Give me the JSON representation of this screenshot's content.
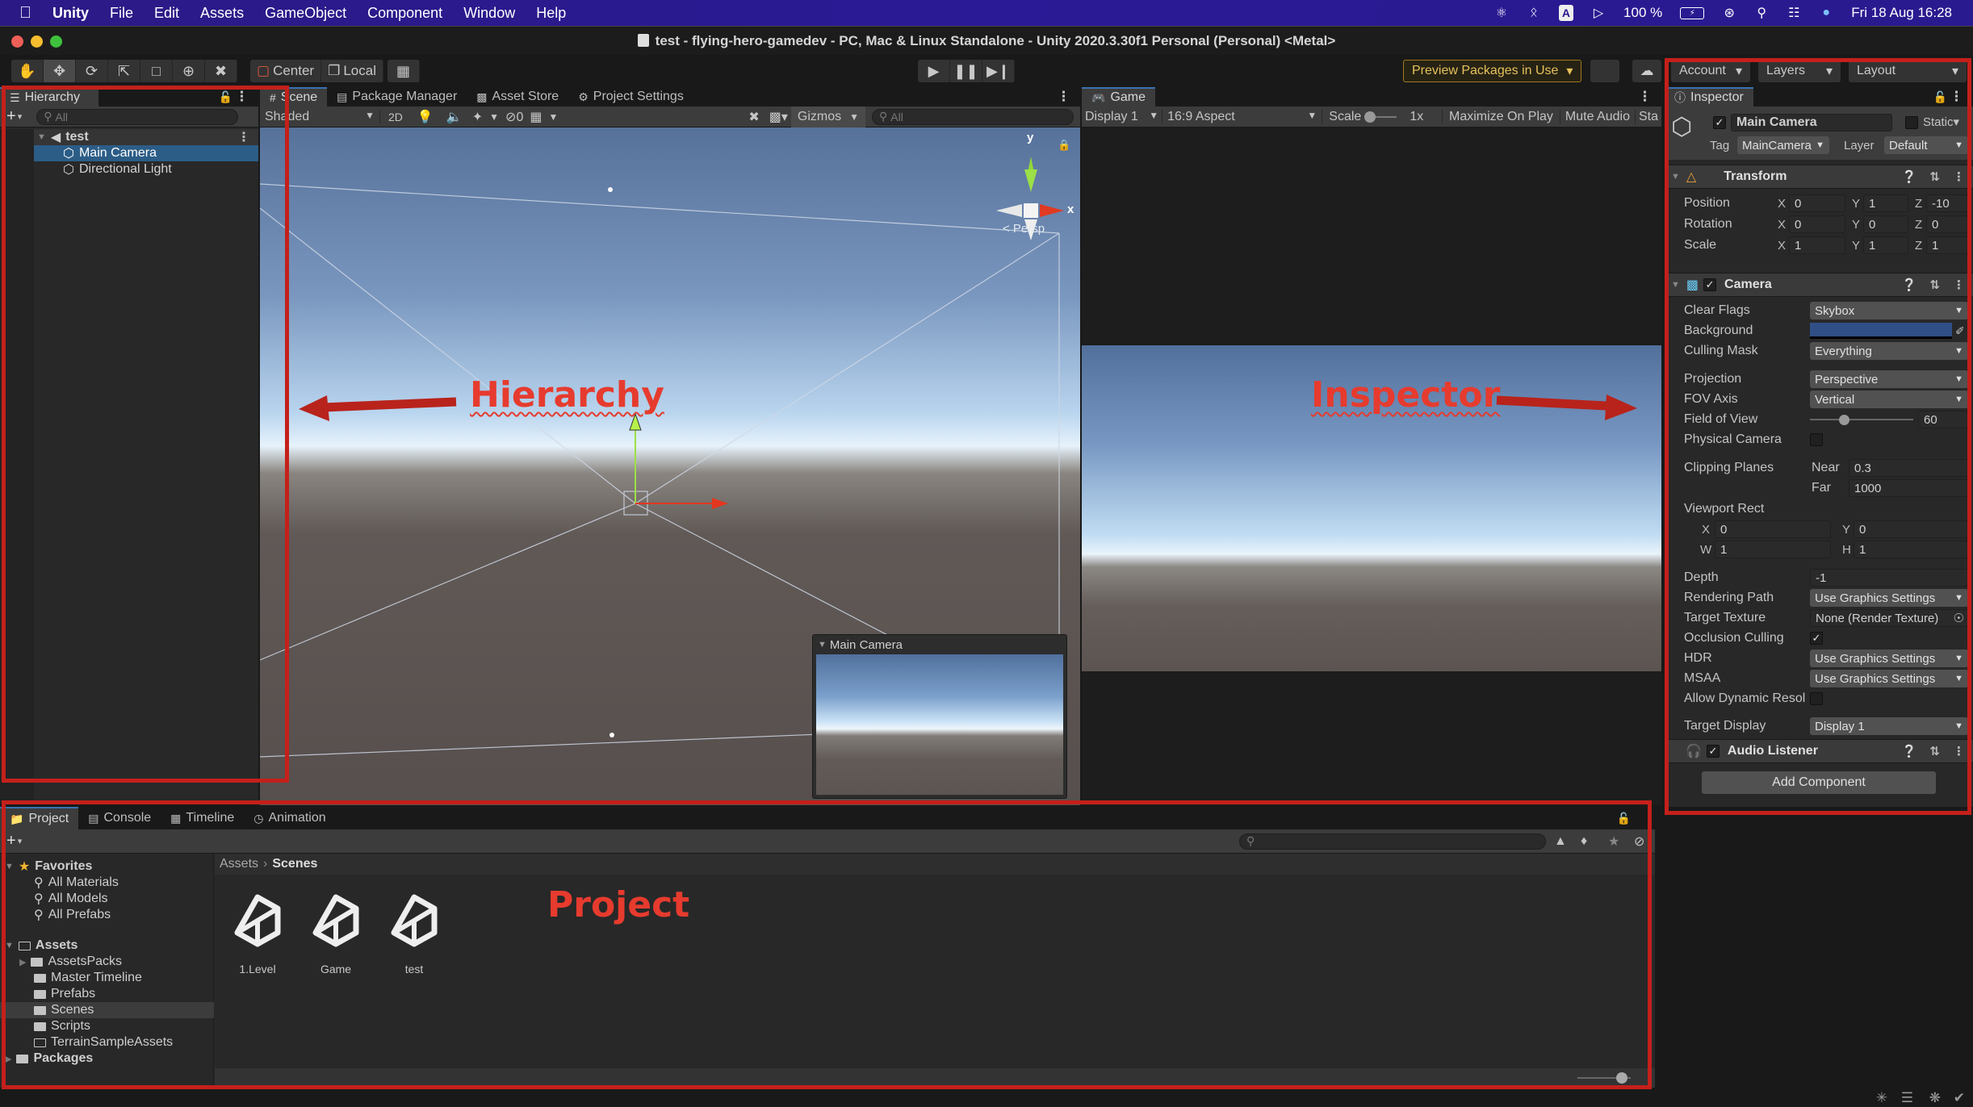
{
  "menubar": {
    "apple": "",
    "app": "Unity",
    "items": [
      "File",
      "Edit",
      "Assets",
      "GameObject",
      "Component",
      "Window",
      "Help"
    ],
    "status": {
      "keyboard": "A",
      "battery": "100 %",
      "datetime": "Fri 18 Aug  16:28"
    }
  },
  "window": {
    "title": "test - flying-hero-gamedev - PC, Mac & Linux Standalone - Unity 2020.3.30f1 Personal (Personal) <Metal>"
  },
  "toolbar": {
    "tools": [
      "hand",
      "move",
      "rotate",
      "scale",
      "rect",
      "transform",
      "custom"
    ],
    "pivot_label": "Center",
    "space_label": "Local",
    "preview_packages": "Preview Packages in Use",
    "account": "Account",
    "layers": "Layers",
    "layout": "Layout"
  },
  "hierarchy": {
    "tab": "Hierarchy",
    "search_placeholder": "All",
    "scene": "test",
    "items": [
      "Main Camera",
      "Directional Light"
    ],
    "selected": "Main Camera"
  },
  "scene": {
    "tabs": [
      "Scene",
      "Package Manager",
      "Asset Store",
      "Project Settings"
    ],
    "shading": "Shaded",
    "mode_2d": "2D",
    "hidden_count": "0",
    "gizmos": "Gizmos",
    "search_placeholder": "All",
    "gizmo_axes": {
      "y": "y",
      "x": "x"
    },
    "projection": "< Persp",
    "camera_preview_title": "Main Camera"
  },
  "game": {
    "tab": "Game",
    "display": "Display 1",
    "aspect": "16:9 Aspect",
    "scale_label": "Scale",
    "scale_value": "1x",
    "maximize": "Maximize On Play",
    "mute": "Mute Audio",
    "stats": "Sta"
  },
  "inspector": {
    "tab": "Inspector",
    "object_name": "Main Camera",
    "active": true,
    "static_label": "Static",
    "tag_label": "Tag",
    "tag": "MainCamera",
    "layer_label": "Layer",
    "layer": "Default",
    "transform": {
      "title": "Transform",
      "rows": [
        {
          "label": "Position",
          "x": "0",
          "y": "1",
          "z": "-10"
        },
        {
          "label": "Rotation",
          "x": "0",
          "y": "0",
          "z": "0"
        },
        {
          "label": "Scale",
          "x": "1",
          "y": "1",
          "z": "1"
        }
      ]
    },
    "camera": {
      "title": "Camera",
      "clear_flags_label": "Clear Flags",
      "clear_flags": "Skybox",
      "background_label": "Background",
      "background_color": "#2f4f86",
      "culling_mask_label": "Culling Mask",
      "culling_mask": "Everything",
      "projection_label": "Projection",
      "projection": "Perspective",
      "fov_axis_label": "FOV Axis",
      "fov_axis": "Vertical",
      "fov_label": "Field of View",
      "fov": "60",
      "fov_min": 1,
      "fov_max": 179,
      "physical_label": "Physical Camera",
      "physical": false,
      "clipping_label": "Clipping Planes",
      "near_label": "Near",
      "near": "0.3",
      "far_label": "Far",
      "far": "1000",
      "viewport_label": "Viewport Rect",
      "vx": "0",
      "vy": "0",
      "vw": "1",
      "vh": "1",
      "depth_label": "Depth",
      "depth": "-1",
      "rendering_path_label": "Rendering Path",
      "rendering_path": "Use Graphics Settings",
      "target_texture_label": "Target Texture",
      "target_texture": "None (Render Texture)",
      "occlusion_label": "Occlusion Culling",
      "occlusion": true,
      "hdr_label": "HDR",
      "hdr": "Use Graphics Settings",
      "msaa_label": "MSAA",
      "msaa": "Use Graphics Settings",
      "dynamic_res_label": "Allow Dynamic Resol",
      "dynamic_res": false,
      "target_display_label": "Target Display",
      "target_display": "Display 1"
    },
    "audio_listener": {
      "title": "Audio Listener",
      "enabled": true
    },
    "add_component": "Add Component"
  },
  "project": {
    "tabs": [
      "Project",
      "Console",
      "Timeline",
      "Animation"
    ],
    "favorites_label": "Favorites",
    "favorites": [
      "All Materials",
      "All Models",
      "All Prefabs"
    ],
    "assets_label": "Assets",
    "folders": [
      "AssetsPacks",
      "Master Timeline",
      "Prefabs",
      "Scenes",
      "Scripts",
      "TerrainSampleAssets"
    ],
    "selected_folder": "Scenes",
    "packages_label": "Packages",
    "breadcrumb": [
      "Assets",
      "Scenes"
    ],
    "files": [
      "1.Level",
      "Game",
      "test"
    ]
  },
  "annotations": {
    "hierarchy": "Hierarchy",
    "inspector": "Inspector",
    "project": "Project",
    "color": "#c4201b"
  }
}
